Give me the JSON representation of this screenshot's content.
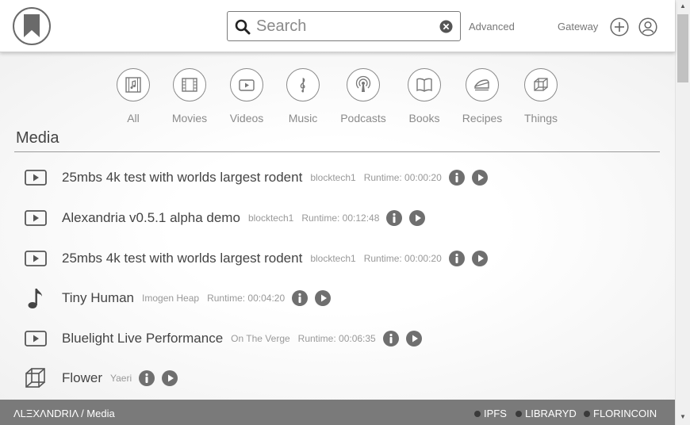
{
  "header": {
    "logo_icon": "bookmark-logo-icon",
    "search": {
      "placeholder": "Search",
      "value": ""
    },
    "advanced_label": "Advanced",
    "gateway_label": "Gateway",
    "add_icon": "plus-circle-icon",
    "user_icon": "user-circle-icon"
  },
  "categories": [
    {
      "label": "All",
      "icon": "all-media-icon"
    },
    {
      "label": "Movies",
      "icon": "film-icon"
    },
    {
      "label": "Videos",
      "icon": "video-play-icon"
    },
    {
      "label": "Music",
      "icon": "treble-clef-icon"
    },
    {
      "label": "Podcasts",
      "icon": "podcast-icon"
    },
    {
      "label": "Books",
      "icon": "book-icon"
    },
    {
      "label": "Recipes",
      "icon": "pie-icon"
    },
    {
      "label": "Things",
      "icon": "cube-icon"
    }
  ],
  "section": {
    "title": "Media"
  },
  "media": [
    {
      "type": "video",
      "title": "25mbs 4k test with worlds largest rodent",
      "publisher": "blocktech1",
      "runtime": "Runtime: 00:00:20"
    },
    {
      "type": "video",
      "title": "Alexandria v0.5.1 alpha demo",
      "publisher": "blocktech1",
      "runtime": "Runtime: 00:12:48"
    },
    {
      "type": "video",
      "title": "25mbs 4k test with worlds largest rodent",
      "publisher": "blocktech1",
      "runtime": "Runtime: 00:00:20"
    },
    {
      "type": "music",
      "title": "Tiny Human",
      "publisher": "Imogen Heap",
      "runtime": "Runtime: 00:04:20"
    },
    {
      "type": "video",
      "title": "Bluelight Live Performance",
      "publisher": "On The Verge",
      "runtime": "Runtime: 00:06:35"
    },
    {
      "type": "thing",
      "title": "Flower",
      "publisher": "Yaeri",
      "runtime": ""
    }
  ],
  "footer": {
    "breadcrumb": "ΛLΞXΛNDRIΛ / Media",
    "status": [
      "IPFS",
      "LIBRARYD",
      "FLORINCOIN"
    ]
  }
}
